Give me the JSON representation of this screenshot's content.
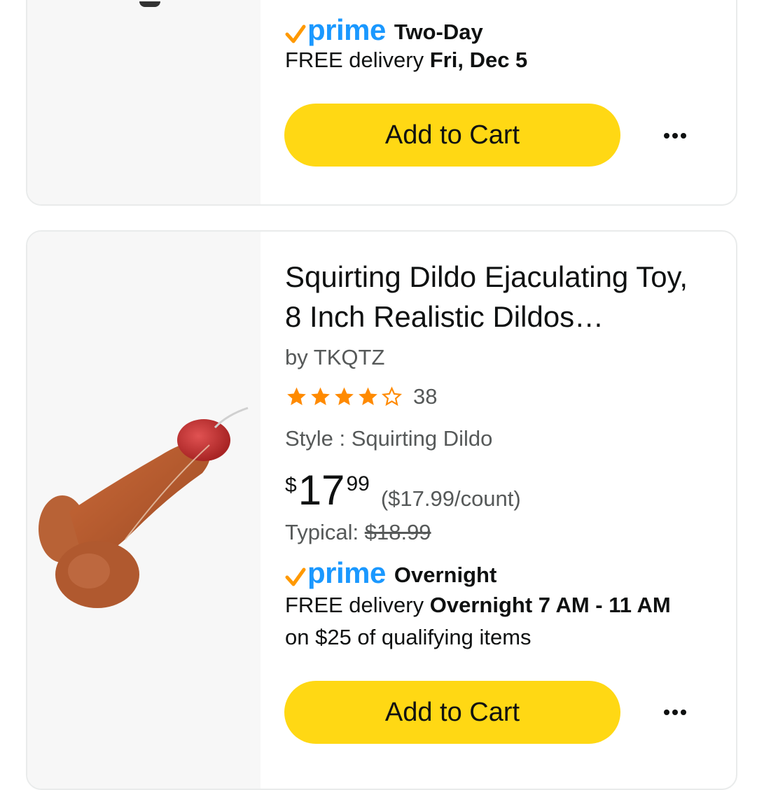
{
  "cards": [
    {
      "prime_badge": "prime",
      "delivery_speed": "Two-Day",
      "delivery_prefix": "FREE delivery",
      "delivery_date": "Fri, Dec 5",
      "add_to_cart": "Add to Cart",
      "more_icon": "ellipsis-icon"
    },
    {
      "title": "Squirting Dildo Ejaculating Toy, 8 Inch Realistic Dildos…",
      "brand": "by TKQTZ",
      "rating": 4.5,
      "rating_count": "38",
      "style": "Style : Squirting Dildo",
      "price_symbol": "$",
      "price_whole": "17",
      "price_fraction": "99",
      "unit_price": "($17.99/count)",
      "typical_label": "Typical:",
      "typical_price": "$18.99",
      "prime_badge": "prime",
      "delivery_speed": "Overnight",
      "delivery_prefix": "FREE delivery",
      "delivery_date": "Overnight 7 AM - 11 AM",
      "delivery_condition": "on $25 of qualifying items",
      "add_to_cart": "Add to Cart",
      "more_icon": "ellipsis-icon"
    }
  ],
  "colors": {
    "prime_blue": "#1a98ff",
    "prime_check": "#ff9900",
    "cart_yellow": "#ffd814",
    "star_orange": "#ff8a00",
    "secondary_text": "#565959"
  }
}
